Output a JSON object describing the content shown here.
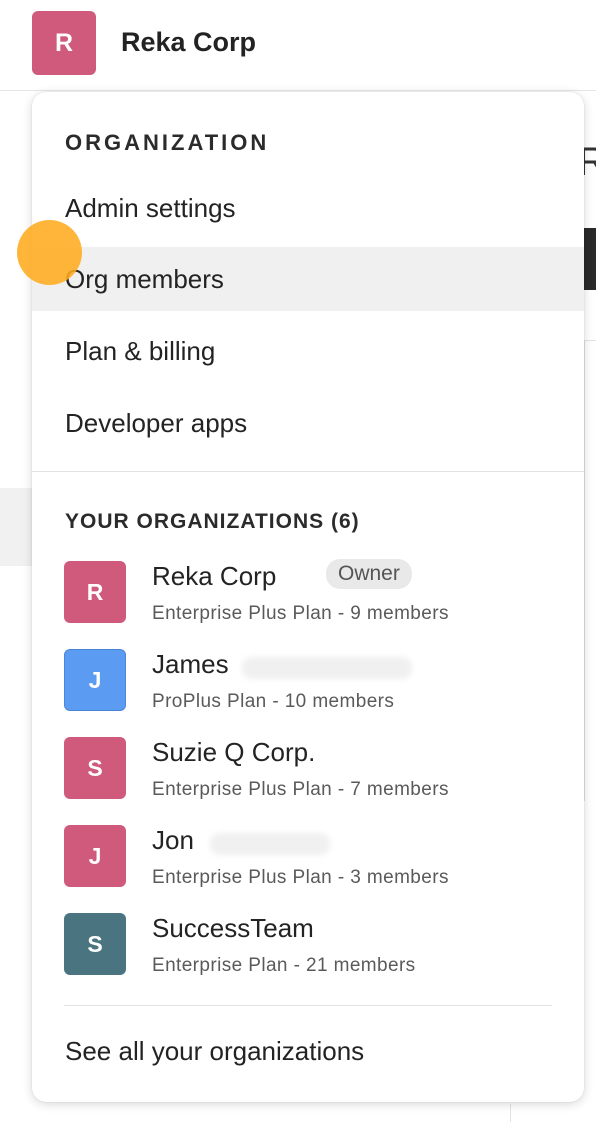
{
  "header": {
    "avatar_letter": "R",
    "title": "Reka Corp"
  },
  "menu": {
    "section_title": "ORGANIZATION",
    "items": [
      {
        "label": "Admin settings"
      },
      {
        "label": "Org members"
      },
      {
        "label": "Plan & billing"
      },
      {
        "label": "Developer apps"
      }
    ],
    "active_item": "Org members",
    "orgs_title": "YOUR ORGANIZATIONS (6)",
    "orgs": [
      {
        "letter": "R",
        "name": "Reka Corp",
        "badge": "Owner",
        "plan": "Enterprise Plus Plan - 9 members",
        "color": "#d05a7c"
      },
      {
        "letter": "J",
        "name": "James",
        "plan": "ProPlus Plan - 10 members",
        "color": "#5b9cf2"
      },
      {
        "letter": "S",
        "name": "Suzie Q Corp.",
        "plan": "Enterprise Plus Plan - 7 members",
        "color": "#d05a7c"
      },
      {
        "letter": "J",
        "name": "Jon",
        "plan": "Enterprise Plus Plan - 3 members",
        "color": "#d05a7c"
      },
      {
        "letter": "S",
        "name": "SuccessTeam",
        "plan": "Enterprise Plan - 21 members",
        "color": "#4a7580"
      }
    ],
    "see_all_label": "See all your organizations"
  },
  "background": {
    "right_letter": "R"
  },
  "colors": {
    "touch_indicator": "#ffab1e",
    "active_row": "#f0f0f0"
  }
}
